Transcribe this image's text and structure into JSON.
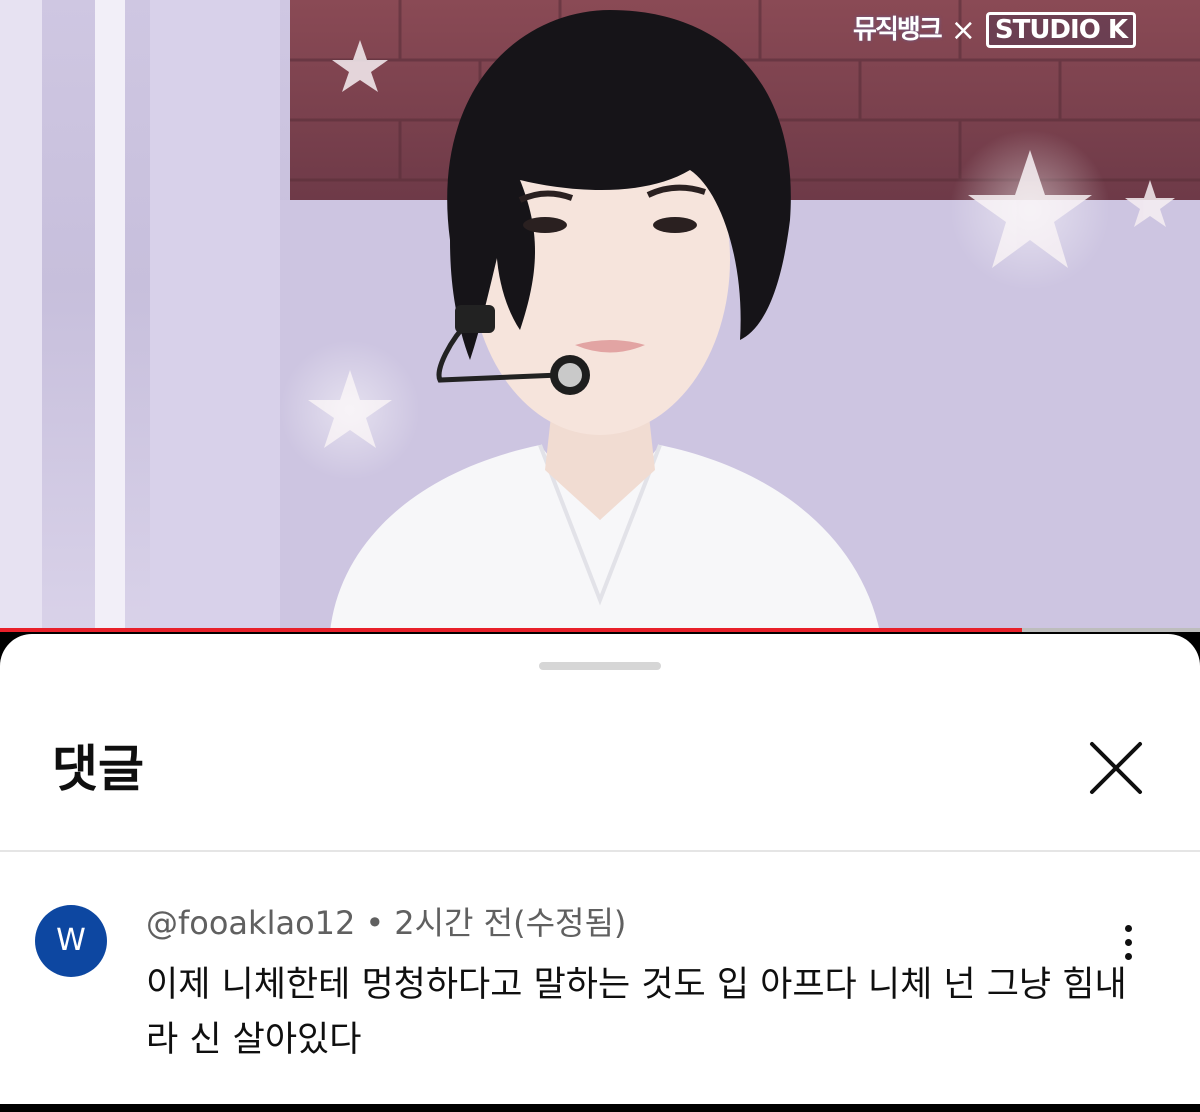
{
  "video": {
    "logo": {
      "music_bank": "뮤직뱅크",
      "separator": "×",
      "studio": "STUDIO K"
    },
    "progress": 0.852,
    "progress_color": "#e8202a"
  },
  "comments_panel": {
    "title": "댓글",
    "close_icon": "close-icon",
    "comments": [
      {
        "avatar_letter": "W",
        "avatar_color": "#0d47a1",
        "author": "@fooaklao12",
        "separator": "•",
        "time": "2시간 전(수정됨)",
        "text": "이제 니체한테 멍청하다고 말하는 것도 입 아프다 니체 넌 그냥 힘내라 신 살아있다",
        "more_icon": "more-vertical-icon"
      }
    ]
  }
}
